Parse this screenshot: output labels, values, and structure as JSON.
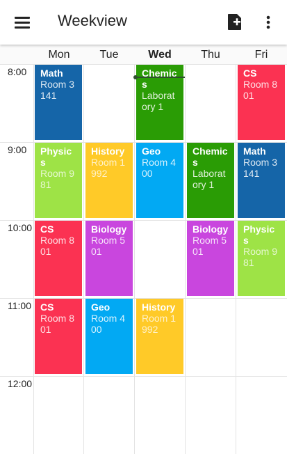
{
  "appbar": {
    "title": "Weekview",
    "icons": [
      "menu-icon",
      "add-calendar-icon",
      "more-vertical-icon"
    ]
  },
  "days": [
    "Mon",
    "Tue",
    "Wed",
    "Thu",
    "Fri"
  ],
  "today": "Wed",
  "times": [
    "8:00",
    "9:00",
    "10:00",
    "11:00",
    "12:00"
  ],
  "colors": {
    "blue_dark": "#1565a8",
    "red": "#fb3252",
    "green": "#2a9c05",
    "lime": "#9ee346",
    "yellow": "#ffca28",
    "sky": "#02a9f3",
    "purple": "#c946de"
  },
  "events": {
    "mon_8": {
      "title": "Math",
      "room": "Room 3141"
    },
    "wed_8": {
      "title": "Chemics",
      "room": "Laboratory 1"
    },
    "fri_8": {
      "title": "CS",
      "room": "Room 801"
    },
    "mon_9": {
      "title": "Physics",
      "room": "Room 981"
    },
    "tue_9": {
      "title": "History",
      "room": "Room 1992"
    },
    "wed_9": {
      "title": "Geo",
      "room": "Room 400"
    },
    "thu_9": {
      "title": "Chemics",
      "room": "Laboratory 1"
    },
    "fri_9": {
      "title": "Math",
      "room": "Room 3141"
    },
    "mon_10": {
      "title": "CS",
      "room": "Room 801"
    },
    "tue_10": {
      "title": "Biology",
      "room": "Room 501"
    },
    "thu_10": {
      "title": "Biology",
      "room": "Room 501"
    },
    "fri_10": {
      "title": "Physics",
      "room": "Room 981"
    },
    "mon_11": {
      "title": "CS",
      "room": "Room 801"
    },
    "tue_11": {
      "title": "Geo",
      "room": "Room 400"
    },
    "wed_11": {
      "title": "History",
      "room": "Room 1992"
    }
  }
}
